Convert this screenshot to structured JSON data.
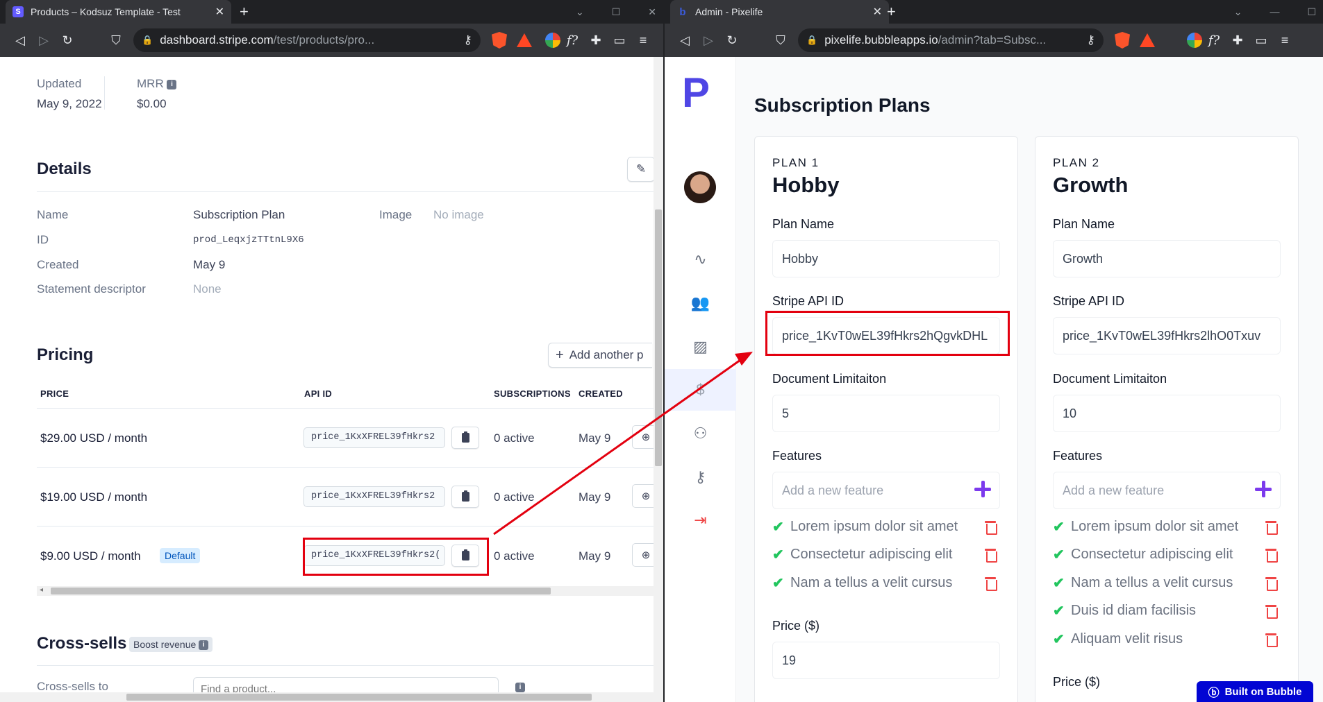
{
  "left_browser": {
    "tab_title": "Products – Kodsuz Template - Test",
    "url_host": "dashboard.stripe.com",
    "url_path": "/test/products/pro...",
    "brave_count": "1"
  },
  "right_browser": {
    "tab_title": "Admin - Pixelife",
    "url_host": "pixelife.bubbleapps.io",
    "url_path": "/admin?tab=Subsc..."
  },
  "stripe": {
    "updated_label": "Updated",
    "updated_value": "May 9, 2022",
    "mrr_label": "MRR",
    "mrr_value": "$0.00",
    "details_title": "Details",
    "details": {
      "name_label": "Name",
      "name_value": "Subscription Plan",
      "image_label": "Image",
      "image_value": "No image",
      "id_label": "ID",
      "id_value": "prod_LeqxjzTTtnL9X6",
      "created_label": "Created",
      "created_value": "May 9",
      "descriptor_label": "Statement descriptor",
      "descriptor_value": "None"
    },
    "pricing_title": "Pricing",
    "add_price_label": "Add another p",
    "columns": [
      "PRICE",
      "API ID",
      "SUBSCRIPTIONS",
      "CREATED"
    ],
    "prices": [
      {
        "price": "$29.00 USD / month",
        "api_id": "price_1KxXFREL39fHkrs2",
        "subs": "0 active",
        "created": "May 9",
        "badge": ""
      },
      {
        "price": "$19.00 USD / month",
        "api_id": "price_1KxXFREL39fHkrs2",
        "subs": "0 active",
        "created": "May 9",
        "badge": ""
      },
      {
        "price": "$9.00 USD / month",
        "api_id": "price_1KxXFREL39fHkrs2(",
        "subs": "0 active",
        "created": "May 9",
        "badge": "Default"
      }
    ],
    "cross_sells_title": "Cross-sells",
    "boost_label": "Boost revenue",
    "cross_sells_to_label": "Cross-sells to",
    "find_product_placeholder": "Find a product..."
  },
  "pixelife": {
    "page_title": "Subscription Plans",
    "plans": [
      {
        "num": "PLAN 1",
        "title": "Hobby",
        "plan_name_label": "Plan Name",
        "plan_name": "Hobby",
        "stripe_label": "Stripe API ID",
        "stripe_id": "price_1KvT0wEL39fHkrs2hQgvkDHL",
        "doc_label": "Document Limitaiton",
        "doc_limit": "5",
        "features_label": "Features",
        "feature_placeholder": "Add a new feature",
        "features": [
          "Lorem ipsum dolor sit amet",
          "Consectetur adipiscing elit",
          "Nam a tellus a velit cursus"
        ],
        "price_label": "Price ($)",
        "price": "19"
      },
      {
        "num": "PLAN 2",
        "title": "Growth",
        "plan_name_label": "Plan Name",
        "plan_name": "Growth",
        "stripe_label": "Stripe API ID",
        "stripe_id": "price_1KvT0wEL39fHkrs2lhO0Txuv",
        "doc_label": "Document Limitaiton",
        "doc_limit": "10",
        "features_label": "Features",
        "feature_placeholder": "Add a new feature",
        "features": [
          "Lorem ipsum dolor sit amet",
          "Consectetur adipiscing elit",
          "Nam a tellus a velit cursus",
          "Duis id diam facilisis",
          "Aliquam velit risus"
        ],
        "price_label": "Price ($)"
      }
    ],
    "bubble_badge": "Built on Bubble"
  },
  "colors": {
    "annotation_red": "#e3000f",
    "brand_indigo": "#4f46e5",
    "check_green": "#22c55e",
    "trash_red": "#ef4444",
    "plus_purple": "#7c3aed",
    "stripe_badge_bg": "#d6ecff"
  }
}
